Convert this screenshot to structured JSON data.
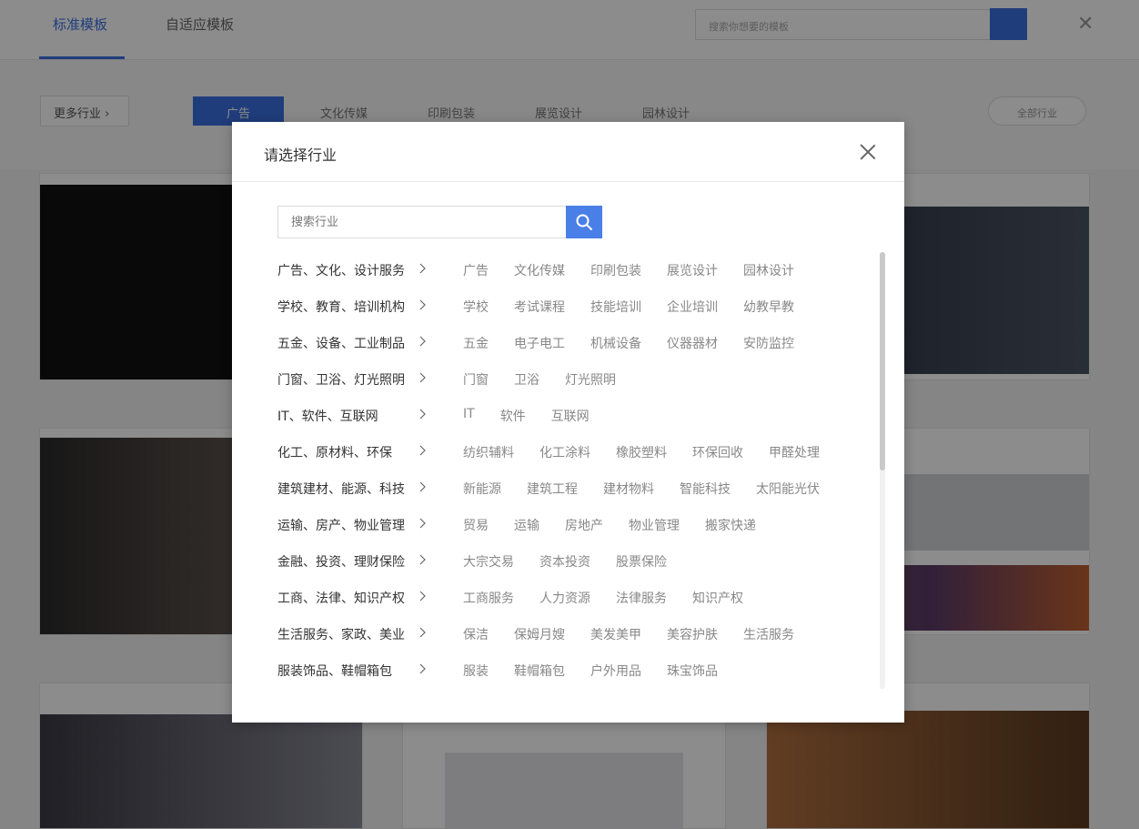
{
  "colors": {
    "accent": "#4a7fe8",
    "bg_accent": "#3b6fe0"
  },
  "background": {
    "tabs": [
      "标准模板",
      "自适应模板"
    ],
    "search_placeholder": "搜索你想要的模板",
    "industry_select": "更多行业 ›",
    "chips": [
      "广告",
      "文化传媒",
      "印刷包装",
      "展览设计",
      "园林设计"
    ],
    "more_button": "全部行业"
  },
  "modal": {
    "title": "请选择行业",
    "search_placeholder": "搜索行业",
    "categories": [
      {
        "label": "广告、文化、设计服务",
        "subs": [
          "广告",
          "文化传媒",
          "印刷包装",
          "展览设计",
          "园林设计"
        ]
      },
      {
        "label": "学校、教育、培训机构",
        "subs": [
          "学校",
          "考试课程",
          "技能培训",
          "企业培训",
          "幼教早教"
        ]
      },
      {
        "label": "五金、设备、工业制品",
        "subs": [
          "五金",
          "电子电工",
          "机械设备",
          "仪器器材",
          "安防监控"
        ]
      },
      {
        "label": "门窗、卫浴、灯光照明",
        "subs": [
          "门窗",
          "卫浴",
          "灯光照明"
        ]
      },
      {
        "label": "IT、软件、互联网",
        "subs": [
          "IT",
          "软件",
          "互联网"
        ]
      },
      {
        "label": "化工、原材料、环保",
        "subs": [
          "纺织辅料",
          "化工涂料",
          "橡胶塑料",
          "环保回收",
          "甲醛处理"
        ]
      },
      {
        "label": "建筑建材、能源、科技",
        "subs": [
          "新能源",
          "建筑工程",
          "建材物料",
          "智能科技",
          "太阳能光伏"
        ]
      },
      {
        "label": "运输、房产、物业管理",
        "subs": [
          "贸易",
          "运输",
          "房地产",
          "物业管理",
          "搬家快递"
        ]
      },
      {
        "label": "金融、投资、理财保险",
        "subs": [
          "大宗交易",
          "资本投资",
          "股票保险"
        ]
      },
      {
        "label": "工商、法律、知识产权",
        "subs": [
          "工商服务",
          "人力资源",
          "法律服务",
          "知识产权"
        ]
      },
      {
        "label": "生活服务、家政、美业",
        "subs": [
          "保洁",
          "保姆月嫂",
          "美发美甲",
          "美容护肤",
          "生活服务"
        ]
      },
      {
        "label": "服装饰品、鞋帽箱包",
        "subs": [
          "服装",
          "鞋帽箱包",
          "户外用品",
          "珠宝饰品"
        ]
      }
    ]
  }
}
